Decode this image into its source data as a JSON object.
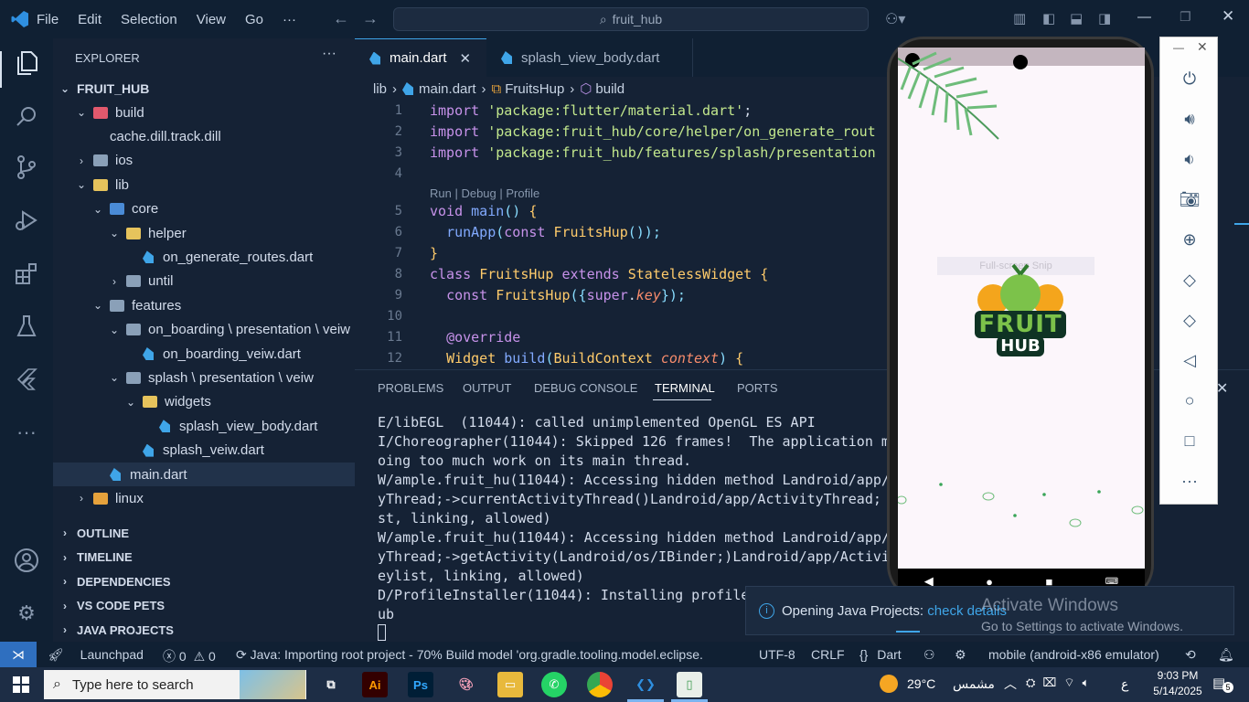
{
  "titlebar": {
    "menu": [
      "File",
      "Edit",
      "Selection",
      "View",
      "Go",
      "···"
    ],
    "search": "fruit_hub"
  },
  "sidebar": {
    "header": "EXPLORER",
    "root": "FRUIT_HUB",
    "tree": [
      {
        "label": "build",
        "depth": 1,
        "type": "folder-open",
        "color": "#e2596d"
      },
      {
        "label": "cache.dill.track.dill",
        "depth": 2,
        "type": "file"
      },
      {
        "label": "ios",
        "depth": 1,
        "type": "folder",
        "color": "#8aa0b8"
      },
      {
        "label": "lib",
        "depth": 1,
        "type": "folder-open",
        "color": "#e6c35c"
      },
      {
        "label": "core",
        "depth": 2,
        "type": "folder-open",
        "color": "#4a8bd6"
      },
      {
        "label": "helper",
        "depth": 3,
        "type": "folder-open",
        "color": "#e6c35c"
      },
      {
        "label": "on_generate_routes.dart",
        "depth": 4,
        "type": "dart"
      },
      {
        "label": "until",
        "depth": 3,
        "type": "folder",
        "color": "#8aa0b8"
      },
      {
        "label": "features",
        "depth": 2,
        "type": "folder-open",
        "color": "#8aa0b8"
      },
      {
        "label": "on_boarding \\ presentation \\ veiw",
        "depth": 3,
        "type": "folder-open",
        "color": "#8aa0b8"
      },
      {
        "label": "on_boarding_veiw.dart",
        "depth": 4,
        "type": "dart"
      },
      {
        "label": "splash \\ presentation \\ veiw",
        "depth": 3,
        "type": "folder-open",
        "color": "#8aa0b8"
      },
      {
        "label": "widgets",
        "depth": 4,
        "type": "folder-open",
        "color": "#e6c35c"
      },
      {
        "label": "splash_view_body.dart",
        "depth": 5,
        "type": "dart"
      },
      {
        "label": "splash_veiw.dart",
        "depth": 4,
        "type": "dart"
      },
      {
        "label": "main.dart",
        "depth": 2,
        "type": "dart",
        "selected": true
      },
      {
        "label": "linux",
        "depth": 1,
        "type": "folder",
        "color": "#e6a23c"
      }
    ],
    "sections": [
      "OUTLINE",
      "TIMELINE",
      "DEPENDENCIES",
      "VS CODE PETS",
      "JAVA PROJECTS"
    ]
  },
  "editor": {
    "tabs": [
      {
        "label": "main.dart",
        "active": true
      },
      {
        "label": "splash_view_body.dart",
        "active": false
      }
    ],
    "breadcrumb": [
      "lib",
      "main.dart",
      "FruitsHup",
      "build"
    ],
    "codelens": "Run | Debug | Profile",
    "line_numbers": [
      "1",
      "2",
      "3",
      "4",
      "5",
      "6",
      "7",
      "8",
      "9",
      "10",
      "11",
      "12"
    ]
  },
  "panel": {
    "tabs": [
      "PROBLEMS",
      "OUTPUT",
      "DEBUG CONSOLE",
      "TERMINAL",
      "PORTS"
    ],
    "active_tab": "TERMINAL",
    "terminal": [
      "E/libEGL  (11044): called unimplemented OpenGL ES API",
      "I/Choreographer(11044): Skipped 126 frames!  The application m",
      "oing too much work on its main thread.",
      "W/ample.fruit_hu(11044): Accessing hidden method Landroid/app/",
      "yThread;->currentActivityThread()Landroid/app/ActivityThread;",
      "st, linking, allowed)",
      "W/ample.fruit_hu(11044): Accessing hidden method Landroid/app/",
      "yThread;->getActivity(Landroid/os/IBinder;)Landroid/app/Activi",
      "eylist, linking, allowed)",
      "D/ProfileInstaller(11044): Installing profile",
      "ub"
    ]
  },
  "emulator": {
    "logo_line1": "FRUIT",
    "logo_line2": "HUB",
    "overlay_text": "Full-screen Snip",
    "tools": [
      "power-icon",
      "volume-up-icon",
      "volume-down-icon",
      "camera-icon",
      "zoom-icon",
      "rotate-left-icon",
      "rotate-right-icon",
      "back-icon",
      "home-icon",
      "overview-icon",
      "more-icon"
    ]
  },
  "notification": {
    "text": "Opening Java Projects: ",
    "link": "check details",
    "watermark_title": "Activate Windows",
    "watermark_sub": "Go to Settings to activate Windows."
  },
  "statusbar": {
    "launchpad": "Launchpad",
    "errors": "0",
    "warnings": "0",
    "java": "Java: Importing root project - 70% Build model 'org.gradle.tooling.model.eclipse.",
    "encoding": "UTF-8",
    "eol": "CRLF",
    "language": "Dart",
    "device": "mobile (android-x86 emulator)"
  },
  "taskbar": {
    "search_placeholder": "Type here to search",
    "temperature": "29°C",
    "weather_text": "مشمس",
    "time": "9:03 PM",
    "date": "5/14/2025",
    "lang": "ع",
    "notif_count": "5"
  },
  "colors": {
    "bg": "#152235",
    "accent": "#3fa5e8",
    "keyword": "#c792ea",
    "string": "#c3e88d"
  }
}
